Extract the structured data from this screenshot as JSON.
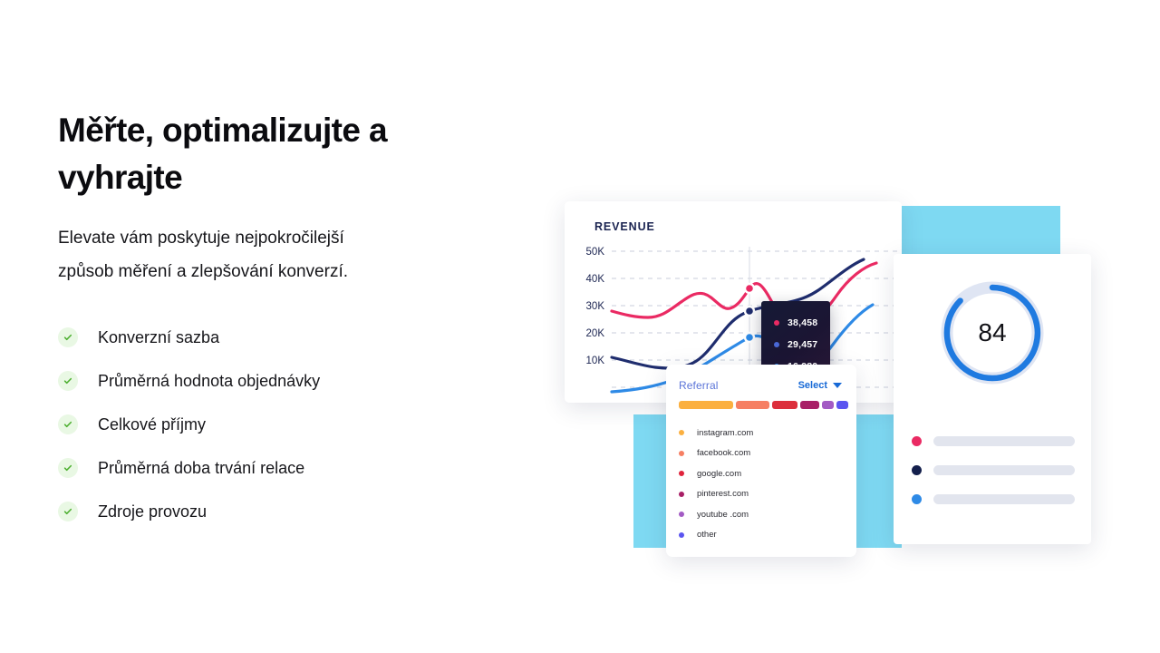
{
  "hero": {
    "headline": "Měřte, optimalizujte a vyhrajte",
    "subheadline": "Elevate vám poskytuje nejpokročilejší způsob měření a zlepšování konverzí.",
    "features": [
      {
        "label": "Konverzní sazba",
        "icon": "check-icon"
      },
      {
        "label": "Průměrná hodnota objednávky",
        "icon": "check-icon"
      },
      {
        "label": "Celkové příjmy",
        "icon": "check-icon"
      },
      {
        "label": "Průměrná doba trvání relace",
        "icon": "check-icon"
      },
      {
        "label": "Zdroje provozu",
        "icon": "check-icon"
      }
    ]
  },
  "revenue_card": {
    "title": "REVENUE",
    "tooltip": [
      {
        "value": "38,458",
        "color": "#ea2a63"
      },
      {
        "value": "29,457",
        "color": "#4a68d6"
      },
      {
        "value": "16,980",
        "color": "#2e8ae6"
      }
    ]
  },
  "referral_card": {
    "title": "Referral",
    "select_label": "Select",
    "select_icon": "chevron-down-icon",
    "segments": [
      {
        "color": "#fbb040",
        "width": 60
      },
      {
        "color": "#f67f63",
        "width": 37
      },
      {
        "color": "#dc2f3c",
        "width": 28
      },
      {
        "color": "#a81f66",
        "width": 21
      },
      {
        "color": "#a35bc4",
        "width": 13
      },
      {
        "color": "#5b55f0",
        "width": 13
      }
    ],
    "sources": [
      {
        "name": "instagram.com",
        "color": "#fbb040"
      },
      {
        "name": "facebook.com",
        "color": "#f67f63"
      },
      {
        "name": "google.com",
        "color": "#e0243c"
      },
      {
        "name": "pinterest.com",
        "color": "#a81f66"
      },
      {
        "name": "youtube .com",
        "color": "#a35bc4"
      },
      {
        "name": "other",
        "color": "#5b55f0"
      }
    ]
  },
  "gauge_card": {
    "value": "84",
    "percent": 84,
    "arc_color": "#1f7ae0",
    "track_color": "#dfe5f3",
    "rows": [
      {
        "color": "#ea2a63"
      },
      {
        "color": "#141f4c"
      },
      {
        "color": "#2e8ae6"
      }
    ]
  },
  "chart_data": {
    "type": "line",
    "title": "REVENUE",
    "xlabel": "",
    "ylabel": "",
    "ylim": [
      0,
      55000
    ],
    "yticks": [
      10000,
      20000,
      30000,
      40000,
      50000
    ],
    "ytick_labels": [
      "10K",
      "20K",
      "30K",
      "40K",
      "50K"
    ],
    "grid": true,
    "legend": false,
    "x": [
      0,
      1,
      2,
      3,
      4,
      5,
      6,
      7,
      8,
      9,
      10
    ],
    "series": [
      {
        "name": "38,458",
        "color": "#ea2a63",
        "values": [
          28000,
          26500,
          27000,
          32500,
          29000,
          31500,
          38458,
          21000,
          22000,
          36000,
          44000
        ],
        "marker_index": 6,
        "marker_value": 38458
      },
      {
        "name": "29,457",
        "color": "#1f2d6e",
        "values": [
          12000,
          10000,
          8800,
          8800,
          15000,
          23000,
          29457,
          33000,
          34000,
          41000,
          47500
        ],
        "marker_index": 6,
        "marker_value": 29457
      },
      {
        "name": "16,980",
        "color": "#2e8ae6",
        "values": [
          2000,
          2500,
          3500,
          5500,
          8500,
          12500,
          16980,
          13000,
          10500,
          15000,
          25500
        ],
        "marker_index": 6,
        "marker_value": 16980
      }
    ],
    "annotations": [
      {
        "type": "tooltip",
        "x_index": 6,
        "values": [
          "38,458",
          "29,457",
          "16,980"
        ]
      },
      {
        "type": "vertical-cursor",
        "x_index": 6
      }
    ]
  }
}
